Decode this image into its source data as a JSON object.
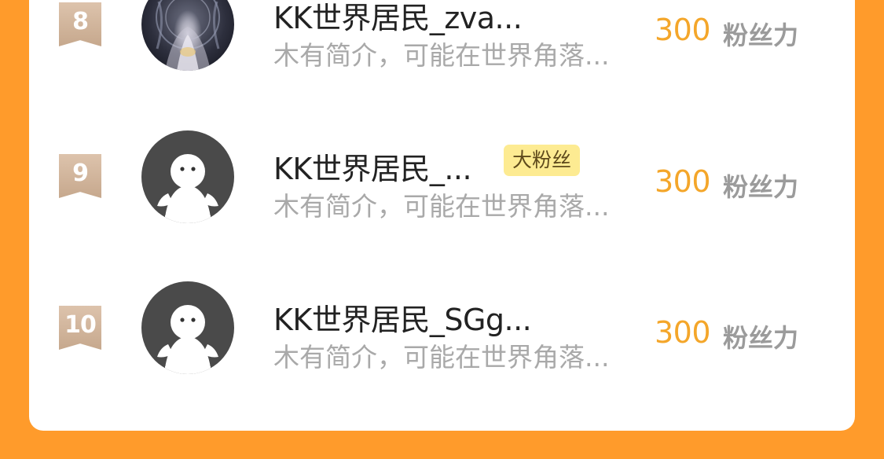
{
  "rows": [
    {
      "rank": "8",
      "name": "KK世界居民_zva...",
      "badge": "",
      "desc": "木有简介，可能在世界角落...",
      "score": "300",
      "unit": "粉丝力",
      "avatar": "custom-image"
    },
    {
      "rank": "9",
      "name": "KK世界居民_...",
      "badge": "大粉丝",
      "desc": "木有简介，可能在世界角落...",
      "score": "300",
      "unit": "粉丝力",
      "avatar": "default-avatar"
    },
    {
      "rank": "10",
      "name": "KK世界居民_SGg...",
      "badge": "",
      "desc": "木有简介，可能在世界角落...",
      "score": "300",
      "unit": "粉丝力",
      "avatar": "default-avatar"
    }
  ],
  "colors": {
    "page_background": "#ff9b2b",
    "card": "#ffffff",
    "score": "#f4a62a",
    "badge": "#fdeb92",
    "rank_badge": "#c6a88d"
  }
}
